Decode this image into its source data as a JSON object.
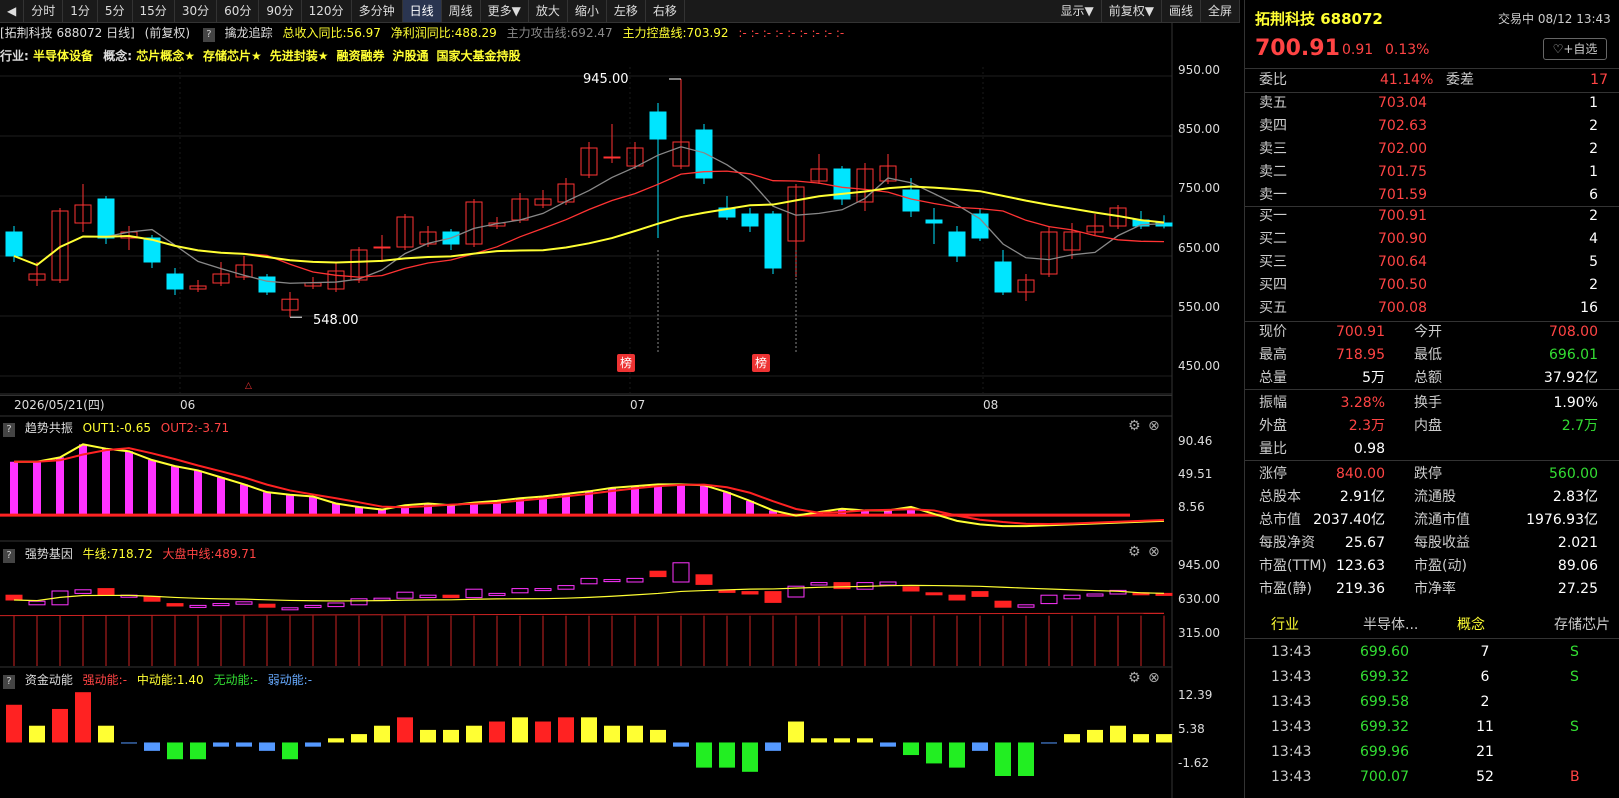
{
  "toolbar": {
    "items": [
      "分时",
      "1分",
      "5分",
      "15分",
      "30分",
      "60分",
      "90分",
      "120分",
      "多分钟",
      "日线",
      "周线",
      "更多▼",
      "放大",
      "缩小",
      "左移",
      "右移"
    ],
    "active": "日线",
    "right_items": [
      "显示▼",
      "前复权▼",
      "画线",
      "全屏"
    ]
  },
  "infobar": {
    "chart_title": "[拓荆科技 688072 日线]",
    "adjust": "(前复权)",
    "indicator": "擒龙追踪",
    "revenue_yoy": "总收入同比:56.97",
    "profit_yoy": "净利润同比:488.29",
    "main_attack": "主力攻击线:692.47",
    "main_control": "主力控盘线:703.92",
    "dash_marks": ":- :- :- :- :- :- :- :- :-"
  },
  "concepts": {
    "industry_label": "行业:",
    "industry": "半导体设备",
    "concept_label": "概念:",
    "items": [
      "芯片概念★",
      "存储芯片★",
      "先进封装★",
      "融资融券",
      "沪股通",
      "国家大基金持股"
    ]
  },
  "main_chart": {
    "y_ticks": [
      "950.00",
      "850.00",
      "750.00",
      "650.00",
      "550.00",
      "450.00"
    ],
    "high_label": "945.00",
    "low_label": "548.00",
    "bang_label": "榜",
    "date_label": "2026/05/21(四)",
    "month_labels": [
      "06",
      "07",
      "08"
    ],
    "tri_label": "△"
  },
  "pane1": {
    "title": "趋势共振",
    "out1": "OUT1:-0.65",
    "out2": "OUT2:-3.71",
    "y_ticks": [
      "90.46",
      "49.51",
      "8.56"
    ]
  },
  "pane2": {
    "title": "强势基因",
    "niu": "牛线:718.72",
    "dapan": "大盘中线:489.71",
    "y_ticks": [
      "945.00",
      "630.00",
      "315.00"
    ]
  },
  "pane3": {
    "title": "资金动能",
    "strong": "强动能:-",
    "mid": "中动能:1.40",
    "none": "无动能:-",
    "weak": "弱动能:-",
    "y_ticks": [
      "12.39",
      "5.38",
      "-1.62"
    ]
  },
  "quote": {
    "name": "拓荆科技",
    "code": "688072",
    "trade_day": "交易中 08/12 13:43",
    "price": "700.91",
    "change": "0.91",
    "change_pct": "0.13%",
    "fav_button": "+自选",
    "weibi_label": "委比",
    "weibi": "41.14%",
    "weicha_label": "委差",
    "weicha": "17",
    "asks": [
      {
        "label": "卖五",
        "price": "703.04",
        "vol": "1"
      },
      {
        "label": "卖四",
        "price": "702.63",
        "vol": "2"
      },
      {
        "label": "卖三",
        "price": "702.00",
        "vol": "2"
      },
      {
        "label": "卖二",
        "price": "701.75",
        "vol": "1"
      },
      {
        "label": "卖一",
        "price": "701.59",
        "vol": "6"
      }
    ],
    "bids": [
      {
        "label": "买一",
        "price": "700.91",
        "vol": "2"
      },
      {
        "label": "买二",
        "price": "700.90",
        "vol": "4"
      },
      {
        "label": "买三",
        "price": "700.64",
        "vol": "5"
      },
      {
        "label": "买四",
        "price": "700.50",
        "vol": "2"
      },
      {
        "label": "买五",
        "price": "700.08",
        "vol": "16"
      }
    ],
    "stats": [
      {
        "l1": "现价",
        "v1": "700.91",
        "c1": "#ff4444",
        "l2": "今开",
        "v2": "708.00",
        "c2": "#ff4444"
      },
      {
        "l1": "最高",
        "v1": "718.95",
        "c1": "#ff4444",
        "l2": "最低",
        "v2": "696.01",
        "c2": "#33dd33"
      },
      {
        "l1": "总量",
        "v1": "5万",
        "c1": "#ffffff",
        "l2": "总额",
        "v2": "37.92亿",
        "c2": "#ffffff"
      },
      {
        "l1": "振幅",
        "v1": "3.28%",
        "c1": "#ff4444",
        "l2": "换手",
        "v2": "1.90%",
        "c2": "#ffffff"
      },
      {
        "l1": "外盘",
        "v1": "2.3万",
        "c1": "#ff4444",
        "l2": "内盘",
        "v2": "2.7万",
        "c2": "#33dd33"
      },
      {
        "l1": "量比",
        "v1": "0.98",
        "c1": "#ffffff",
        "l2": "",
        "v2": "",
        "c2": "#ffffff"
      },
      {
        "l1": "涨停",
        "v1": "840.00",
        "c1": "#ff4444",
        "l2": "跌停",
        "v2": "560.00",
        "c2": "#33dd33"
      },
      {
        "l1": "总股本",
        "v1": "2.91亿",
        "c1": "#ffffff",
        "l2": "流通股",
        "v2": "2.83亿",
        "c2": "#ffffff"
      },
      {
        "l1": "总市值",
        "v1": "2037.40亿",
        "c1": "#ffffff",
        "l2": "流通市值",
        "v2": "1976.93亿",
        "c2": "#ffffff"
      },
      {
        "l1": "每股净资",
        "v1": "25.67",
        "c1": "#ffffff",
        "l2": "每股收益",
        "v2": "2.021",
        "c2": "#ffffff"
      },
      {
        "l1": "市盈(TTM)",
        "v1": "123.63",
        "c1": "#ffffff",
        "l2": "市盈(动)",
        "v2": "89.06",
        "c2": "#ffffff"
      },
      {
        "l1": "市盈(静)",
        "v1": "219.36",
        "c1": "#ffffff",
        "l2": "市净率",
        "v2": "27.25",
        "c2": "#ffffff"
      }
    ],
    "category": {
      "l1": "行业",
      "v1": "半导体...",
      "l2": "概念",
      "v2": "存储芯片"
    },
    "ticks": [
      {
        "time": "13:43",
        "price": "699.60",
        "vol": "7",
        "flag": "S",
        "fc": "#33dd33"
      },
      {
        "time": "13:43",
        "price": "699.32",
        "vol": "6",
        "flag": "S",
        "fc": "#33dd33"
      },
      {
        "time": "13:43",
        "price": "699.58",
        "vol": "2",
        "flag": "",
        "fc": "#33dd33"
      },
      {
        "time": "13:43",
        "price": "699.32",
        "vol": "11",
        "flag": "S",
        "fc": "#33dd33"
      },
      {
        "time": "13:43",
        "price": "699.96",
        "vol": "21",
        "flag": "",
        "fc": "#33dd33"
      },
      {
        "time": "13:43",
        "price": "700.07",
        "vol": "52",
        "flag": "B",
        "fc": "#ff4444"
      }
    ]
  },
  "chart_data": [
    {
      "type": "candlestick",
      "y_axis_ticks": [
        950,
        850,
        750,
        650,
        550,
        450
      ],
      "ylim": [
        440,
        960
      ],
      "annotations": [
        "945.00",
        "548.00"
      ],
      "candles": [
        {
          "o": 690,
          "c": 650,
          "h": 700,
          "l": 640
        },
        {
          "o": 610,
          "c": 620,
          "h": 640,
          "l": 600
        },
        {
          "o": 610,
          "c": 725,
          "h": 730,
          "l": 605
        },
        {
          "o": 705,
          "c": 735,
          "h": 770,
          "l": 690
        },
        {
          "o": 745,
          "c": 680,
          "h": 750,
          "l": 670
        },
        {
          "o": 680,
          "c": 690,
          "h": 700,
          "l": 660
        },
        {
          "o": 680,
          "c": 640,
          "h": 685,
          "l": 630
        },
        {
          "o": 620,
          "c": 595,
          "h": 630,
          "l": 585
        },
        {
          "o": 595,
          "c": 600,
          "h": 610,
          "l": 590
        },
        {
          "o": 605,
          "c": 620,
          "h": 640,
          "l": 600
        },
        {
          "o": 615,
          "c": 635,
          "h": 650,
          "l": 610
        },
        {
          "o": 615,
          "c": 590,
          "h": 620,
          "l": 585
        },
        {
          "o": 560,
          "c": 578,
          "h": 590,
          "l": 548
        },
        {
          "o": 600,
          "c": 605,
          "h": 615,
          "l": 595
        },
        {
          "o": 595,
          "c": 625,
          "h": 640,
          "l": 590
        },
        {
          "o": 610,
          "c": 660,
          "h": 665,
          "l": 605
        },
        {
          "o": 665,
          "c": 665,
          "h": 685,
          "l": 640
        },
        {
          "o": 665,
          "c": 715,
          "h": 720,
          "l": 660
        },
        {
          "o": 670,
          "c": 690,
          "h": 700,
          "l": 665
        },
        {
          "o": 690,
          "c": 670,
          "h": 695,
          "l": 660
        },
        {
          "o": 670,
          "c": 740,
          "h": 745,
          "l": 665
        },
        {
          "o": 700,
          "c": 705,
          "h": 715,
          "l": 695
        },
        {
          "o": 710,
          "c": 745,
          "h": 755,
          "l": 705
        },
        {
          "o": 735,
          "c": 745,
          "h": 760,
          "l": 730
        },
        {
          "o": 740,
          "c": 770,
          "h": 780,
          "l": 735
        },
        {
          "o": 785,
          "c": 830,
          "h": 840,
          "l": 780
        },
        {
          "o": 815,
          "c": 815,
          "h": 870,
          "l": 805
        },
        {
          "o": 800,
          "c": 830,
          "h": 840,
          "l": 795
        },
        {
          "o": 890,
          "c": 845,
          "h": 905,
          "l": 680
        },
        {
          "o": 800,
          "c": 840,
          "h": 945,
          "l": 795
        },
        {
          "o": 860,
          "c": 780,
          "h": 870,
          "l": 770
        },
        {
          "o": 730,
          "c": 715,
          "h": 750,
          "l": 710
        },
        {
          "o": 720,
          "c": 700,
          "h": 730,
          "l": 690
        },
        {
          "o": 720,
          "c": 630,
          "h": 725,
          "l": 620
        },
        {
          "o": 675,
          "c": 765,
          "h": 770,
          "l": 615
        },
        {
          "o": 775,
          "c": 795,
          "h": 820,
          "l": 770
        },
        {
          "o": 795,
          "c": 745,
          "h": 800,
          "l": 735
        },
        {
          "o": 740,
          "c": 795,
          "h": 805,
          "l": 725
        },
        {
          "o": 775,
          "c": 800,
          "h": 820,
          "l": 770
        },
        {
          "o": 760,
          "c": 725,
          "h": 780,
          "l": 715
        },
        {
          "o": 710,
          "c": 705,
          "h": 730,
          "l": 670
        },
        {
          "o": 690,
          "c": 650,
          "h": 700,
          "l": 640
        },
        {
          "o": 720,
          "c": 680,
          "h": 730,
          "l": 675
        },
        {
          "o": 640,
          "c": 590,
          "h": 660,
          "l": 585
        },
        {
          "o": 590,
          "c": 610,
          "h": 620,
          "l": 575
        },
        {
          "o": 620,
          "c": 690,
          "h": 700,
          "l": 615
        },
        {
          "o": 660,
          "c": 690,
          "h": 705,
          "l": 645
        },
        {
          "o": 690,
          "c": 700,
          "h": 720,
          "l": 685
        },
        {
          "o": 700,
          "c": 730,
          "h": 735,
          "l": 695
        },
        {
          "o": 710,
          "c": 700,
          "h": 725,
          "l": 695
        },
        {
          "o": 705,
          "c": 700,
          "h": 718,
          "l": 696
        }
      ]
    },
    {
      "type": "bar",
      "title": "趋势共振",
      "y_axis_ticks": [
        90.46,
        49.51,
        8.56
      ],
      "ylim": [
        -20,
        100
      ],
      "values": [
        70,
        70,
        75,
        90,
        85,
        82,
        72,
        65,
        60,
        52,
        44,
        35,
        32,
        30,
        22,
        18,
        15,
        20,
        22,
        20,
        23,
        25,
        28,
        30,
        33,
        36,
        40,
        42,
        44,
        44,
        43,
        35,
        25,
        14,
        8,
        12,
        16,
        14,
        14,
        18,
        10,
        8,
        4,
        2,
        2,
        3,
        4,
        5,
        6,
        7,
        8
      ]
    },
    {
      "type": "candlestick",
      "title": "强势基因",
      "y_axis_ticks": [
        945,
        630,
        315
      ],
      "ylim": [
        90,
        1130
      ],
      "bars": [
        {
          "o": 690,
          "c": 650
        },
        {
          "o": 610,
          "c": 640
        },
        {
          "o": 610,
          "c": 725
        },
        {
          "o": 705,
          "c": 735
        },
        {
          "o": 745,
          "c": 690
        },
        {
          "o": 680,
          "c": 690
        },
        {
          "o": 680,
          "c": 640
        },
        {
          "o": 620,
          "c": 600
        },
        {
          "o": 595,
          "c": 605
        },
        {
          "o": 605,
          "c": 620
        },
        {
          "o": 615,
          "c": 635
        },
        {
          "o": 615,
          "c": 590
        },
        {
          "o": 570,
          "c": 585
        },
        {
          "o": 600,
          "c": 605
        },
        {
          "o": 595,
          "c": 625
        },
        {
          "o": 610,
          "c": 660
        },
        {
          "o": 660,
          "c": 665
        },
        {
          "o": 665,
          "c": 715
        },
        {
          "o": 670,
          "c": 690
        },
        {
          "o": 690,
          "c": 670
        },
        {
          "o": 670,
          "c": 740
        },
        {
          "o": 700,
          "c": 705
        },
        {
          "o": 710,
          "c": 745
        },
        {
          "o": 735,
          "c": 745
        },
        {
          "o": 740,
          "c": 770
        },
        {
          "o": 785,
          "c": 830
        },
        {
          "o": 815,
          "c": 820
        },
        {
          "o": 800,
          "c": 830
        },
        {
          "o": 890,
          "c": 845
        },
        {
          "o": 800,
          "c": 960
        },
        {
          "o": 860,
          "c": 780
        },
        {
          "o": 730,
          "c": 715
        },
        {
          "o": 720,
          "c": 700
        },
        {
          "o": 720,
          "c": 630
        },
        {
          "o": 675,
          "c": 765
        },
        {
          "o": 775,
          "c": 795
        },
        {
          "o": 795,
          "c": 745
        },
        {
          "o": 740,
          "c": 795
        },
        {
          "o": 775,
          "c": 800
        },
        {
          "o": 760,
          "c": 725
        },
        {
          "o": 710,
          "c": 705
        },
        {
          "o": 690,
          "c": 650
        },
        {
          "o": 720,
          "c": 680
        },
        {
          "o": 640,
          "c": 590
        },
        {
          "o": 590,
          "c": 610
        },
        {
          "o": 620,
          "c": 690
        },
        {
          "o": 660,
          "c": 690
        },
        {
          "o": 690,
          "c": 700
        },
        {
          "o": 700,
          "c": 730
        },
        {
          "o": 710,
          "c": 700
        },
        {
          "o": 705,
          "c": 700
        }
      ]
    },
    {
      "type": "bar",
      "title": "资金动能",
      "y_axis_ticks": [
        12.39,
        5.38,
        -1.62
      ],
      "ylim": [
        -5,
        15
      ],
      "values": [
        9,
        4,
        8,
        12,
        4,
        0,
        -2,
        -4,
        -4,
        -1,
        -1,
        -2,
        -4,
        -1,
        1,
        2,
        4,
        6,
        3,
        3,
        4,
        5,
        6,
        5,
        6,
        6,
        4,
        4,
        3,
        -1,
        -6,
        -6,
        -7,
        -2,
        5,
        1,
        1,
        1,
        -1,
        -3,
        -5,
        -6,
        -2,
        -8,
        -8,
        0,
        2,
        3,
        4,
        2,
        2
      ]
    }
  ]
}
